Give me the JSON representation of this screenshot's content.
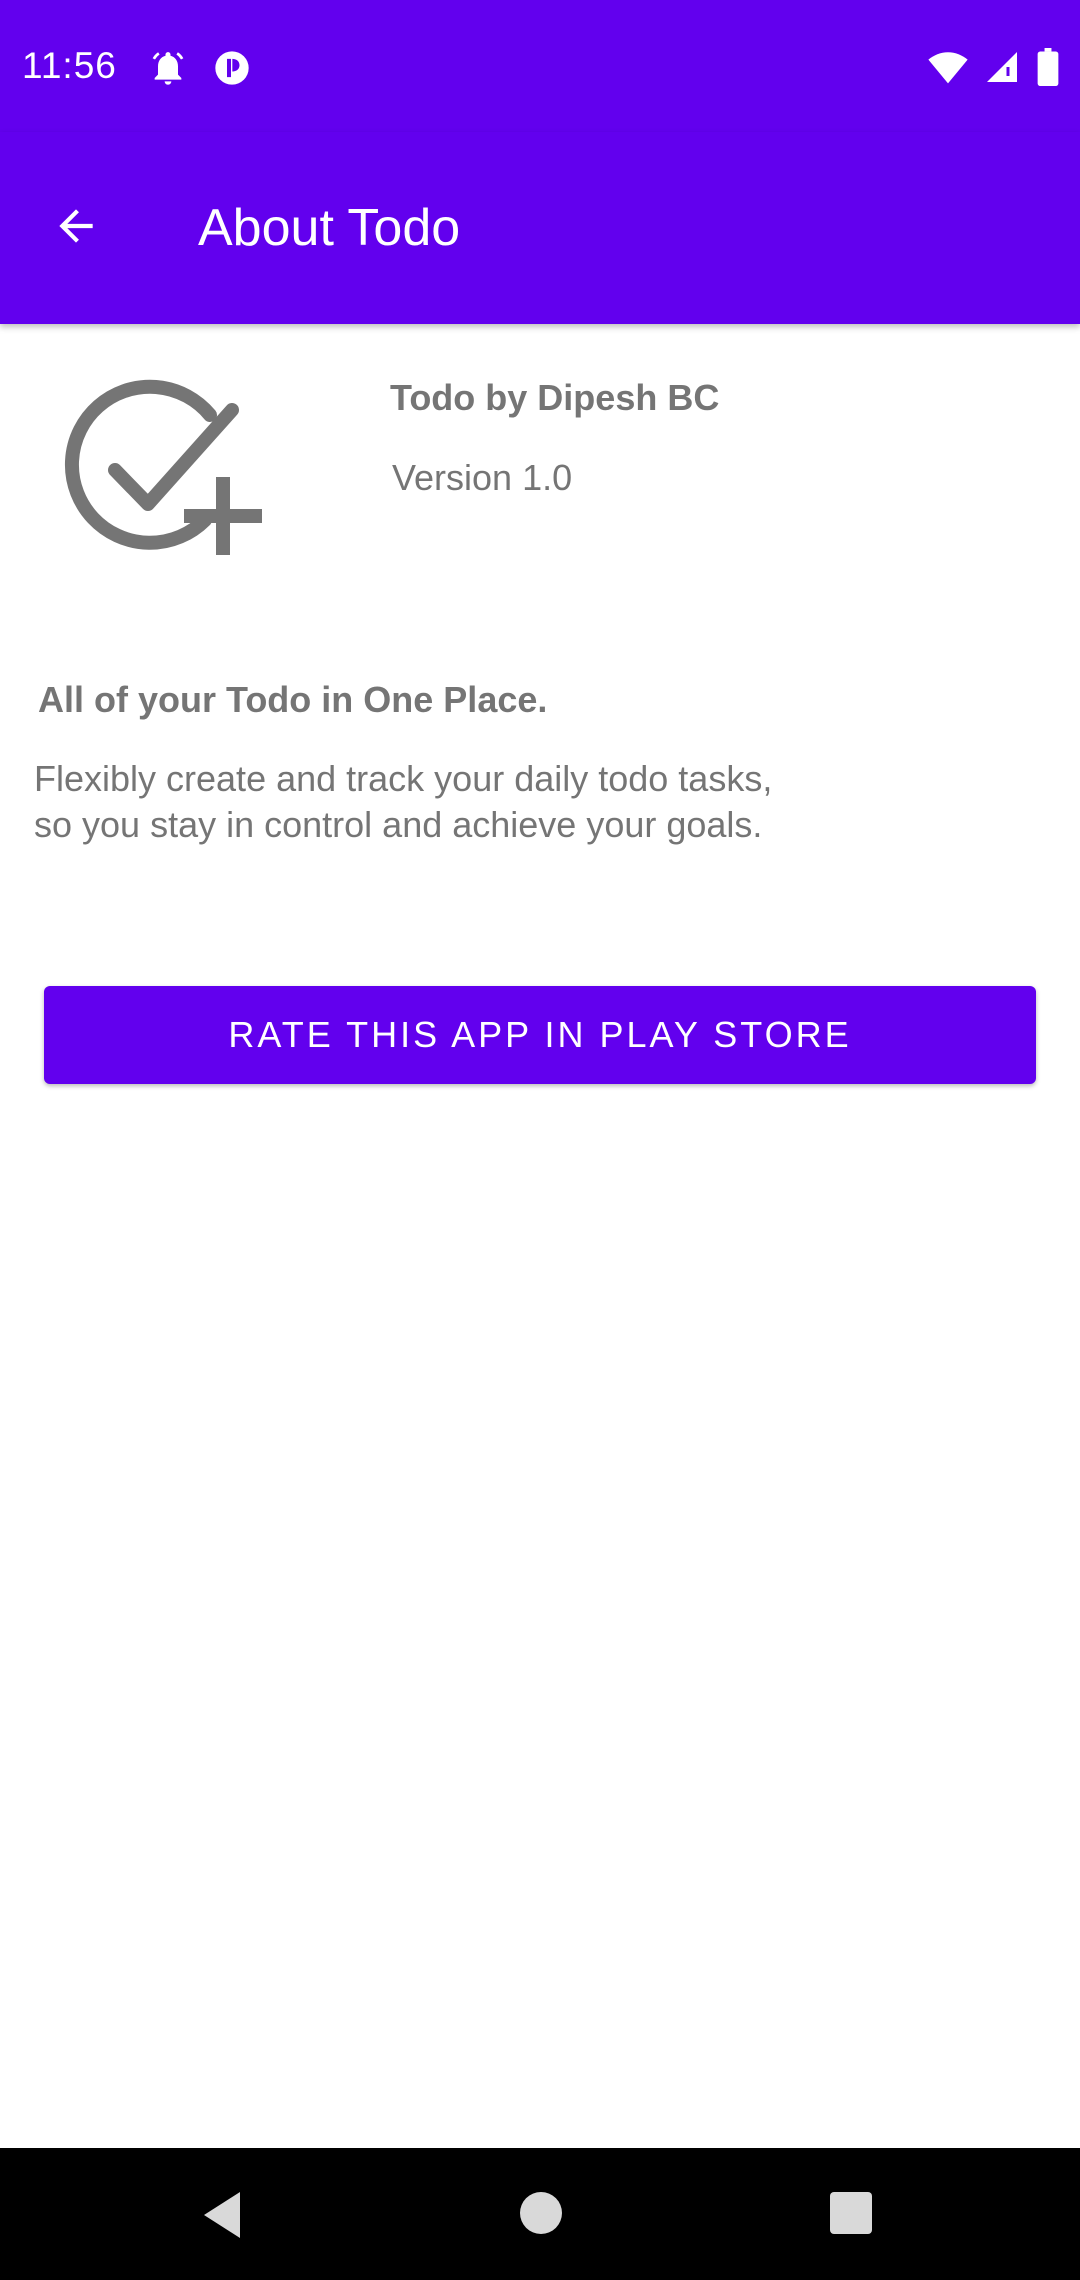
{
  "status_bar": {
    "time": "11:56",
    "icons": [
      "alarm-icon",
      "app-notification-icon",
      "wifi-icon",
      "cell-signal-icon",
      "battery-icon"
    ]
  },
  "app_bar": {
    "title": "About Todo",
    "back_icon": "arrow-back-icon"
  },
  "about": {
    "logo_icon": "check-plus-icon",
    "app_name": "Todo by Dipesh BC",
    "version": "Version 1.0",
    "tagline": "All of your Todo in One Place.",
    "description": "Flexibly create and track your daily todo tasks, so you stay in control and achieve your goals."
  },
  "actions": {
    "rate_label": "RATE THIS APP IN PLAY STORE"
  },
  "nav_bar": {
    "icons": [
      "nav-back-icon",
      "nav-home-icon",
      "nav-recents-icon"
    ]
  },
  "colors": {
    "primary": "#6200ee",
    "text_secondary": "#757575",
    "icon_gray": "#757575"
  }
}
